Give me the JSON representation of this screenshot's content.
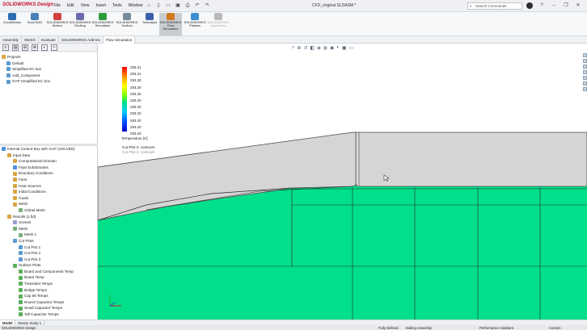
{
  "app": {
    "brand": "SOLIDWORKS Design",
    "document_title": "CFD_original.SLDASM *"
  },
  "menu": [
    "File",
    "Edit",
    "View",
    "Insert",
    "Tools",
    "Window"
  ],
  "search": {
    "placeholder": "Search Commands"
  },
  "ribbon": [
    {
      "label": "CircuitWorks",
      "color": "#2b6cb0",
      "active": false,
      "disabled": false
    },
    {
      "label": "ScanTo3D",
      "color": "#4a7fb8",
      "active": false,
      "disabled": false
    },
    {
      "label": "SOLIDWORKS Motion",
      "color": "#d04040",
      "active": false,
      "disabled": false
    },
    {
      "label": "SOLIDWORKS Routing",
      "color": "#6b6bb0",
      "active": false,
      "disabled": false
    },
    {
      "label": "SOLIDWORKS Simulation",
      "color": "#2d9a3c",
      "active": false,
      "disabled": false
    },
    {
      "label": "SOLIDWORKS Toolbox",
      "color": "#7a8a99",
      "active": false,
      "disabled": false
    },
    {
      "label": "TolAnalyst",
      "color": "#3a5fa8",
      "active": false,
      "disabled": false
    },
    {
      "label": "SOLIDWORKS Flow Simulation",
      "color": "#d07a20",
      "active": true,
      "disabled": false
    },
    {
      "label": "SOLIDWORKS Plastics",
      "color": "#3b8fd0",
      "active": false,
      "disabled": false
    },
    {
      "label": "SOLIDWORKS Inspection",
      "color": "#b8b8b8",
      "active": false,
      "disabled": true
    }
  ],
  "command_tabs": [
    {
      "label": "Assembly",
      "selected": false
    },
    {
      "label": "Sketch",
      "selected": false
    },
    {
      "label": "Evaluate",
      "selected": false
    },
    {
      "label": "SOLIDWORKS Add-Ins",
      "selected": false
    },
    {
      "label": "Flow Simulation",
      "selected": true
    }
  ],
  "project_tree": {
    "root": "Projects",
    "items": [
      "Default",
      "Simplified EC box",
      "Add_Component",
      "GAP Simplified EC box"
    ]
  },
  "analysis_tree": {
    "root": "Internal Control Box with GAP (SOLVED)",
    "items": [
      {
        "label": "Input Data",
        "level": 1,
        "icon": "folder-icon",
        "color": "#d9a441"
      },
      {
        "label": "Computational Domain",
        "level": 2,
        "icon": "domain-icon",
        "color": "#d9a441"
      },
      {
        "label": "Fluid Subdomains",
        "level": 2,
        "icon": "fluid-icon",
        "color": "#4a90d9"
      },
      {
        "label": "Boundary Conditions",
        "level": 2,
        "icon": "boundary-icon",
        "color": "#d9a441"
      },
      {
        "label": "Fans",
        "level": 2,
        "icon": "fan-icon",
        "color": "#d9a441"
      },
      {
        "label": "Heat Sources",
        "level": 2,
        "icon": "heat-icon",
        "color": "#d9a441"
      },
      {
        "label": "Initial Conditions",
        "level": 2,
        "icon": "conditions-icon",
        "color": "#d9a441"
      },
      {
        "label": "Goals",
        "level": 2,
        "icon": "goal-icon",
        "color": "#d9a441"
      },
      {
        "label": "Mesh",
        "level": 2,
        "icon": "mesh-icon",
        "color": "#d9a441"
      },
      {
        "label": "Global Mesh",
        "level": 3,
        "icon": "mesh-icon",
        "color": "#7ab07a"
      },
      {
        "label": "Results (1.fld)",
        "level": 1,
        "icon": "results-icon",
        "color": "#d9a441"
      },
      {
        "label": "Scenes",
        "level": 2,
        "icon": "scene-icon",
        "color": "#9a9ad0"
      },
      {
        "label": "Mesh",
        "level": 2,
        "icon": "mesh-icon",
        "color": "#7ab07a"
      },
      {
        "label": "Mesh 1",
        "level": 3,
        "icon": "mesh-icon",
        "color": "#7ab07a"
      },
      {
        "label": "Cut Plots",
        "level": 2,
        "icon": "cutplot-icon",
        "color": "#5a9ad0"
      },
      {
        "label": "Cut Plot 1",
        "level": 3,
        "icon": "cutplot-icon",
        "color": "#5a9ad0"
      },
      {
        "label": "Cut Plot 2",
        "level": 3,
        "icon": "cutplot-icon",
        "color": "#5a9ad0"
      },
      {
        "label": "Cut Plot 3",
        "level": 3,
        "icon": "cutplot-icon",
        "color": "#5a9ad0"
      },
      {
        "label": "Surface Plots",
        "level": 2,
        "icon": "surfaceplot-icon",
        "color": "#5ab05a"
      },
      {
        "label": "Board and Components Temp",
        "level": 3,
        "icon": "surfaceplot-icon",
        "color": "#5ab05a"
      },
      {
        "label": "Board Temp",
        "level": 3,
        "icon": "surfaceplot-icon",
        "color": "#5ab05a"
      },
      {
        "label": "Transistor Temps",
        "level": 3,
        "icon": "surfaceplot-icon",
        "color": "#5ab05a"
      },
      {
        "label": "Bridge Temps",
        "level": 3,
        "icon": "surfaceplot-icon",
        "color": "#5ab05a"
      },
      {
        "label": "Cap 60 Temps",
        "level": 3,
        "icon": "surfaceplot-icon",
        "color": "#5ab05a"
      },
      {
        "label": "Round Capacitor Temps",
        "level": 3,
        "icon": "surfaceplot-icon",
        "color": "#5ab05a"
      },
      {
        "label": "Small Capacitor Temps",
        "level": 3,
        "icon": "surfaceplot-icon",
        "color": "#5ab05a"
      },
      {
        "label": "Tall Capacitor Temps",
        "level": 3,
        "icon": "surfaceplot-icon",
        "color": "#5ab05a"
      }
    ]
  },
  "legend": {
    "ticks": [
      "293.31",
      "293.31",
      "293.30",
      "293.30",
      "293.30",
      "293.20",
      "293.20",
      "293.20",
      "293.20",
      "293.20",
      "293.33"
    ],
    "title": "Temperature [K]"
  },
  "cut_plot_labels": [
    "Cut Plot 2: contours",
    "Cut Plot 2: contours"
  ],
  "bottom_tabs": [
    {
      "label": "Model",
      "selected": true
    },
    {
      "label": "Motion Study 1",
      "selected": false
    }
  ],
  "status": {
    "left": "SOLIDWORKS Design",
    "defined": "Fully Defined",
    "mode": "Editing Assembly",
    "assistant": "Performance Assistant",
    "units": "Custom"
  },
  "colors": {
    "fluid": "#00e08a",
    "solid": "#d5d5d5",
    "accent": "#c8102e"
  }
}
